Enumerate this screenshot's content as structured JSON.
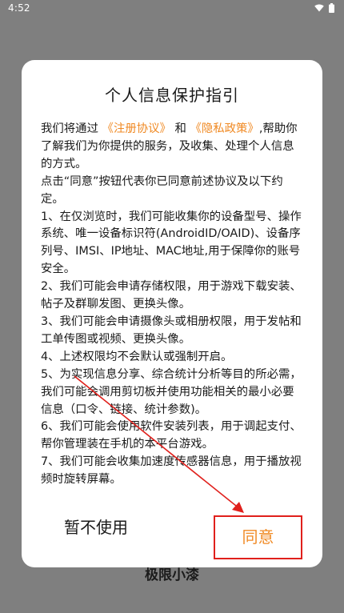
{
  "status_bar": {
    "time": "4:52",
    "icons": [
      "wifi-icon",
      "battery-icon"
    ]
  },
  "background": {
    "app_name": "极限小漆"
  },
  "dialog": {
    "title": "个人信息保护指引",
    "intro": {
      "prefix": "我们将通过",
      "link_register": "《注册协议》",
      "and": "和",
      "link_privacy": "《隐私政策》",
      "suffix": ",帮助你了解我们为你提供的服务，及收集、处理个人信息的方式。"
    },
    "paragraphs": [
      " 点击“同意”按钮代表你已同意前述协议及以下约定。",
      " 1、在仅浏览时，我们可能收集你的设备型号、操作系统、唯一设备标识符(AndroidID/OAID)、设备序列号、IMSI、IP地址、MAC地址,用于保障你的账号安全。",
      " 2、我们可能会申请存储权限，用于游戏下载安装、帖子及群聊发图、更换头像。",
      " 3、我们可能会申请摄像头或相册权限，用于发帖和工单传图或视频、更换头像。",
      " 4、上述权限均不会默认或强制开启。",
      " 5、为实现信息分享、综合统计分析等目的所必需，我们可能会调用剪切板并使用功能相关的最小必要信息（口令、链接、统计参数)。",
      " 6、我们可能会使用软件安装列表，用于调起支付、帮你管理装在手机的本平台游戏。",
      " 7、我们可能会收集加速度传感器信息，用于播放视频时旋转屏幕。"
    ],
    "decline_label": "暂不使用",
    "agree_label": "同意"
  },
  "colors": {
    "link": "#f08a24",
    "annotation": "#e0201c",
    "overlay": "#7f7f7f"
  }
}
